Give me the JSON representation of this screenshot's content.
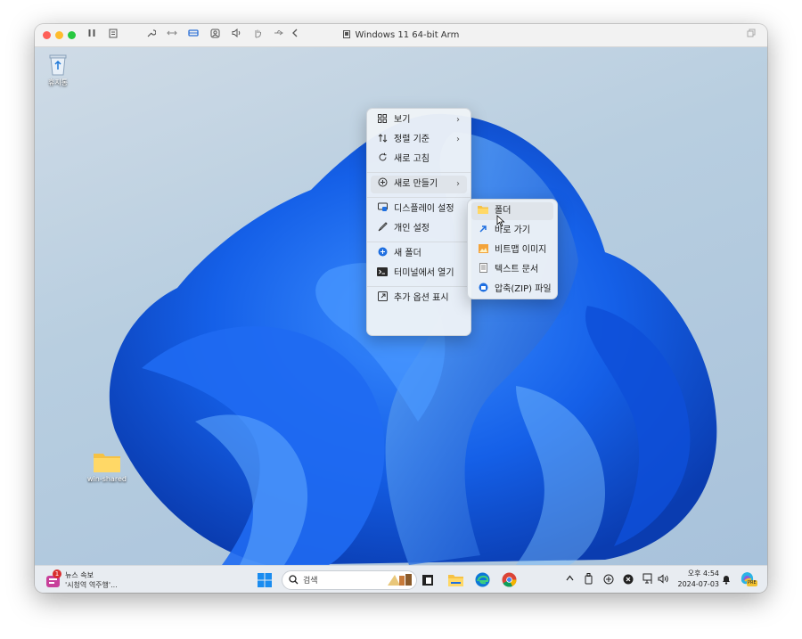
{
  "window": {
    "title": "Windows 11 64-bit Arm",
    "controls": [
      "close-dot",
      "minimize-dot",
      "zoom-dot"
    ],
    "toolbar_icons": [
      "pause-icon",
      "snapshot-icon",
      "wrench-icon",
      "arrows-icon",
      "drive-icon",
      "user-icon",
      "volume-icon",
      "hand-icon",
      "usb-icon",
      "back-icon"
    ],
    "colors": {
      "close": "#fe5f57",
      "minimize": "#febc2e",
      "zoom": "#28c840"
    }
  },
  "desktop": {
    "icons": [
      {
        "label": "휴지통",
        "icon": "recycle-bin-icon"
      },
      {
        "label": "win-shared",
        "icon": "folder-icon"
      }
    ]
  },
  "context_menu": {
    "items": [
      {
        "label": "보기",
        "icon": "grid-icon",
        "submenu": true
      },
      {
        "label": "정렬 기준",
        "icon": "sort-icon",
        "submenu": true
      },
      {
        "label": "새로 고침",
        "icon": "refresh-icon",
        "submenu": false
      },
      {
        "label": "새로 만들기",
        "icon": "plus-circle-icon",
        "submenu": true
      },
      {
        "label": "디스플레이 설정",
        "icon": "display-icon",
        "submenu": false
      },
      {
        "label": "개인 설정",
        "icon": "brush-icon",
        "submenu": false
      },
      {
        "label": "새 폴더",
        "icon": "folder-plus-icon",
        "submenu": false
      },
      {
        "label": "터미널에서 열기",
        "icon": "terminal-icon",
        "submenu": false
      },
      {
        "label": "추가 옵션 표시",
        "icon": "more-options-icon",
        "submenu": false
      }
    ]
  },
  "submenu": {
    "items": [
      {
        "label": "폴더",
        "icon": "folder-icon"
      },
      {
        "label": "바로 가기",
        "icon": "shortcut-icon"
      },
      {
        "label": "비트맵 이미지",
        "icon": "bitmap-icon"
      },
      {
        "label": "텍스트 문서",
        "icon": "text-doc-icon"
      },
      {
        "label": "압축(ZIP) 파일",
        "icon": "zip-icon"
      }
    ]
  },
  "taskbar": {
    "news_badge": "1",
    "news_title": "뉴스 속보",
    "news_subtitle": "'시청역 역주행'...",
    "search_placeholder": "검색",
    "time": "오후 4:54",
    "date": "2024-07-03",
    "copilot_badge": "PRE"
  }
}
